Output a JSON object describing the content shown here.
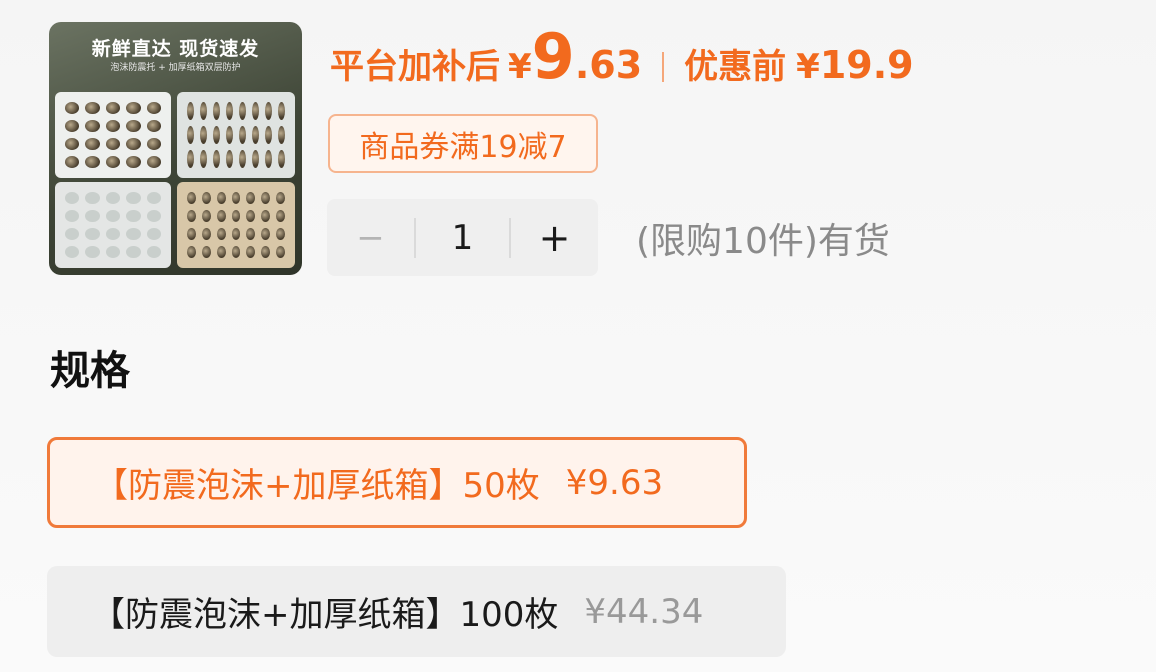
{
  "product": {
    "image": {
      "headline": "新鲜直达 现货速发",
      "subline": "泡沫防震托 + 加厚纸箱双层防护"
    }
  },
  "price": {
    "label": "平台加补后",
    "currency": "¥",
    "int": "9",
    "dec": ".63",
    "orig_label": "优惠前",
    "orig_currency": "¥",
    "orig_price": "19.9"
  },
  "coupon": {
    "text": "商品券满19减7"
  },
  "quantity": {
    "minus": "−",
    "value": "1",
    "plus": "+",
    "stock_text": "(限购10件)有货"
  },
  "spec": {
    "title": "规格",
    "options": [
      {
        "label": "【防震泡沫+加厚纸箱】50枚",
        "price": "¥9.63",
        "selected": true
      },
      {
        "label": "【防震泡沫+加厚纸箱】100枚",
        "price": "¥44.34",
        "selected": false
      }
    ]
  },
  "colors": {
    "accent": "#f26a1e",
    "selected_bg": "#fff3ec",
    "muted_text": "#8a8a8a"
  }
}
